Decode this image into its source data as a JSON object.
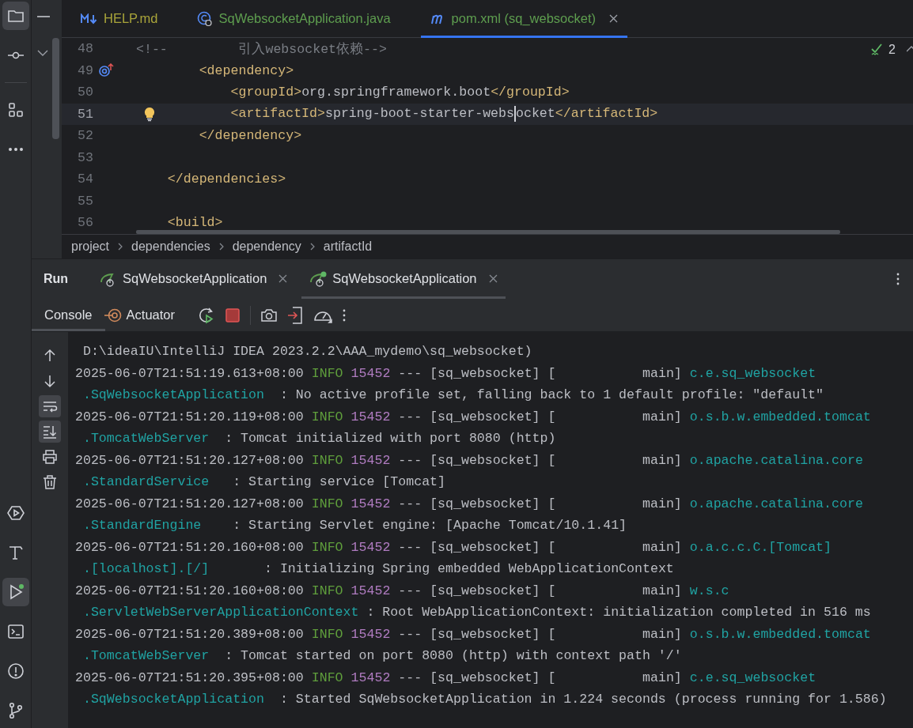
{
  "activity_bar": {
    "top": [
      {
        "kind": "folder",
        "selected": true,
        "running": false
      },
      {
        "kind": "commit",
        "selected": false,
        "running": false
      },
      {
        "kind": "structure",
        "selected": false,
        "running": false
      },
      {
        "kind": "more",
        "selected": false,
        "running": false
      }
    ],
    "bottom": [
      {
        "kind": "services",
        "selected": false,
        "running": false
      },
      {
        "kind": "build",
        "selected": false,
        "running": false
      },
      {
        "kind": "run",
        "selected": true,
        "running": true
      },
      {
        "kind": "terminal",
        "selected": false,
        "running": false
      },
      {
        "kind": "problems",
        "selected": false,
        "running": false
      },
      {
        "kind": "git",
        "selected": false,
        "running": false
      }
    ]
  },
  "editor_tabs": [
    {
      "label": "HELP.md",
      "kind": "markdown",
      "color": "#a9a43a",
      "selected": false,
      "closable": false
    },
    {
      "label": "SqWebsocketApplication.java",
      "kind": "java",
      "color": "#5e9e4f",
      "selected": false,
      "closable": false
    },
    {
      "label": "pom.xml (sq_websocket)",
      "kind": "maven",
      "color": "#5e9e4f",
      "selected": true,
      "closable": true
    }
  ],
  "editor": {
    "inspections": "2",
    "lines": [
      {
        "number": "48",
        "current": false,
        "overridden": false,
        "intention": false,
        "segments": [
          {
            "kind": "comment",
            "text": "<!--         引入websocket依赖-->"
          }
        ]
      },
      {
        "number": "49",
        "current": false,
        "overridden": true,
        "intention": false,
        "segments": [
          {
            "kind": "tag",
            "text": "        <dependency>"
          }
        ]
      },
      {
        "number": "50",
        "current": false,
        "overridden": false,
        "intention": false,
        "segments": [
          {
            "kind": "tag",
            "text": "            <groupId>"
          },
          {
            "kind": "text",
            "text": "org.springframework.boot"
          },
          {
            "kind": "tag",
            "text": "</groupId>"
          }
        ]
      },
      {
        "number": "51",
        "current": true,
        "overridden": false,
        "intention": true,
        "segments": [
          {
            "kind": "tag",
            "text": "            <artifactId>"
          },
          {
            "kind": "text",
            "text": "spring-boot-starter-webs"
          },
          {
            "kind": "caret"
          },
          {
            "kind": "text",
            "text": "ocket"
          },
          {
            "kind": "tag",
            "text": "</artifactId>"
          }
        ]
      },
      {
        "number": "52",
        "current": false,
        "overridden": false,
        "intention": false,
        "segments": [
          {
            "kind": "tag",
            "text": "        </dependency>"
          }
        ]
      },
      {
        "number": "53",
        "current": false,
        "overridden": false,
        "intention": false
      },
      {
        "number": "54",
        "current": false,
        "overridden": false,
        "intention": false,
        "segments": [
          {
            "kind": "tag",
            "text": "    </dependencies>"
          }
        ]
      },
      {
        "number": "55",
        "current": false,
        "overridden": false,
        "intention": false
      },
      {
        "number": "56",
        "current": false,
        "overridden": false,
        "intention": false,
        "segments": [
          {
            "kind": "tag",
            "text": "    <build>"
          }
        ]
      }
    ],
    "breadcrumbs": [
      "project",
      "dependencies",
      "dependency",
      "artifactId"
    ]
  },
  "run_panel": {
    "title": "Run",
    "tabs": [
      {
        "label": "SqWebsocketApplication",
        "running": false,
        "selected": false
      },
      {
        "label": "SqWebsocketApplication",
        "running": true,
        "selected": true
      }
    ],
    "view_tabs": [
      {
        "label": "Console",
        "kind": "console",
        "selected": true
      },
      {
        "label": "Actuator",
        "kind": "actuator",
        "selected": false
      }
    ],
    "console_tools": [
      {
        "kind": "up",
        "selected": false
      },
      {
        "kind": "down",
        "selected": false
      },
      {
        "kind": "wrap",
        "selected": true
      },
      {
        "kind": "scroll-end",
        "selected": true
      },
      {
        "kind": "print",
        "selected": false
      },
      {
        "kind": "clear",
        "selected": false
      }
    ],
    "console": [
      {
        "kind": "plain",
        "text": "D:\\ideaIU\\IntelliJ IDEA 2023.2.2\\AAA_mydemo\\sq_websocket)"
      },
      {
        "kind": "log",
        "timestamp": "2025-06-07T21:51:19.613+08:00",
        "level": "INFO",
        "pid": "15452",
        "thread": "--- [sq_websocket] [           main]",
        "logger_1": "c.e.sq_websocket",
        "logger_2": ".SqWebsocketApplication",
        "message": ": No active profile set, falling back to 1 default profile: \"default\""
      },
      {
        "kind": "log",
        "timestamp": "2025-06-07T21:51:20.119+08:00",
        "level": "INFO",
        "pid": "15452",
        "thread": "--- [sq_websocket] [           main]",
        "logger_1": "o.s.b.w.embedded.tomcat",
        "logger_2": ".TomcatWebServer",
        "message": ": Tomcat initialized with port 8080 (http)"
      },
      {
        "kind": "log",
        "timestamp": "2025-06-07T21:51:20.127+08:00",
        "level": "INFO",
        "pid": "15452",
        "thread": "--- [sq_websocket] [           main]",
        "logger_1": "o.apache.catalina.core",
        "logger_2": ".StandardService",
        "message": ": Starting service [Tomcat]"
      },
      {
        "kind": "log",
        "timestamp": "2025-06-07T21:51:20.127+08:00",
        "level": "INFO",
        "pid": "15452",
        "thread": "--- [sq_websocket] [           main]",
        "logger_1": "o.apache.catalina.core",
        "logger_2": ".StandardEngine",
        "message": ": Starting Servlet engine: [Apache Tomcat/10.1.41]"
      },
      {
        "kind": "log",
        "timestamp": "2025-06-07T21:51:20.160+08:00",
        "level": "INFO",
        "pid": "15452",
        "thread": "--- [sq_websocket] [           main]",
        "logger_1": "o.a.c.c.C.[Tomcat]",
        "logger_2": ".[localhost].[/]",
        "message": ": Initializing Spring embedded WebApplicationContext"
      },
      {
        "kind": "log",
        "timestamp": "2025-06-07T21:51:20.160+08:00",
        "level": "INFO",
        "pid": "15452",
        "thread": "--- [sq_websocket] [           main]",
        "logger_1": "w.s.c",
        "logger_2": ".ServletWebServerApplicationContext",
        "message": ": Root WebApplicationContext: initialization completed in 516 ms"
      },
      {
        "kind": "log",
        "timestamp": "2025-06-07T21:51:20.389+08:00",
        "level": "INFO",
        "pid": "15452",
        "thread": "--- [sq_websocket] [           main]",
        "logger_1": "o.s.b.w.embedded.tomcat",
        "logger_2": ".TomcatWebServer",
        "message": ": Tomcat started on port 8080 (http) with context path '/'"
      },
      {
        "kind": "log",
        "timestamp": "2025-06-07T21:51:20.395+08:00",
        "level": "INFO",
        "pid": "15452",
        "thread": "--- [sq_websocket] [           main]",
        "logger_1": "c.e.sq_websocket",
        "logger_2": ".SqWebsocketApplication",
        "message": ": Started SqWebsocketApplication in 1.224 seconds (process running for 1.586)"
      }
    ]
  }
}
